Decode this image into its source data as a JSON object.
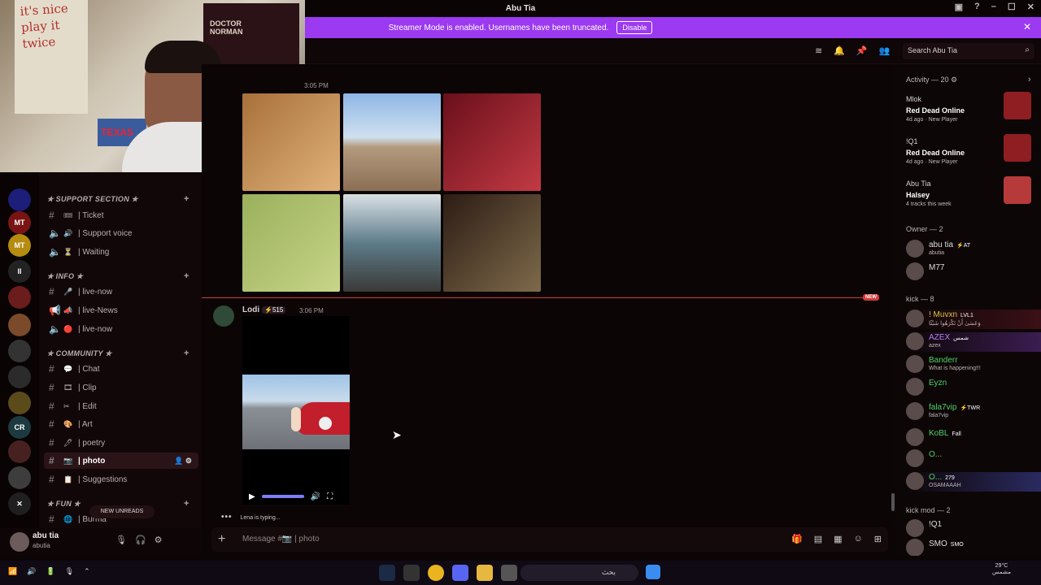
{
  "window": {
    "title": "Abu Tia"
  },
  "banner": {
    "text": "Streamer Mode is enabled. Usernames have been truncated.",
    "action": "Disable"
  },
  "header": {
    "search_placeholder": "Search Abu Tia"
  },
  "channels": {
    "categories": [
      {
        "name": "✯ SUPPORT SECTION ✯",
        "items": [
          {
            "icon": "🎟",
            "label": "| Ticket"
          },
          {
            "icon": "🔊",
            "label": "| Support voice"
          },
          {
            "icon": "⏳",
            "label": "| Waiting"
          }
        ]
      },
      {
        "name": "✯ INFO ✯",
        "items": [
          {
            "icon": "🎤",
            "label": "| live-now"
          },
          {
            "icon": "📣",
            "label": "| live-News"
          },
          {
            "icon": "🔴",
            "label": "| live-now"
          }
        ]
      },
      {
        "name": "✯ COMMUNITY ✯",
        "items": [
          {
            "icon": "💬",
            "label": "| Chat"
          },
          {
            "icon": "🎞",
            "label": "| Clip"
          },
          {
            "icon": "✂",
            "label": "| Edit"
          },
          {
            "icon": "🎨",
            "label": "| Art"
          },
          {
            "icon": "🖊",
            "label": "| poetry"
          },
          {
            "icon": "📷",
            "label": "| photo"
          },
          {
            "icon": "📋",
            "label": "| Suggestions"
          }
        ]
      },
      {
        "name": "✯ FUN ✯",
        "items": [
          {
            "icon": "🌐",
            "label": "| Burma"
          }
        ]
      }
    ],
    "new_unreads": "NEW UNREADS"
  },
  "user": {
    "name": "abu tia",
    "tag": "abutia"
  },
  "messages": {
    "first_time": "3:05 PM",
    "new_badge": "NEW",
    "second": {
      "author": "Lodi",
      "badge": "⚡515",
      "time": "3:06 PM"
    },
    "typing": "Lena is typing...",
    "composer_placeholder": "Message #📷 | photo"
  },
  "activity": {
    "title": "Activity — 20",
    "items": [
      {
        "user": "Mlok",
        "game": "Red Dead Online",
        "meta": "4d ago · New Player",
        "color": "#8f1e22"
      },
      {
        "user": "!Q1",
        "game": "Red Dead Online",
        "meta": "4d ago · New Player",
        "color": "#8f1e22"
      },
      {
        "user": "Abu Tia",
        "game": "Halsey",
        "meta": "4 tracks this week",
        "color": "#b63a3a"
      }
    ]
  },
  "member_groups": [
    {
      "title": "Owner — 2",
      "members": [
        {
          "name": "abu tia",
          "tag": "⚡AT",
          "sub": "abutia"
        },
        {
          "name": "M77",
          "tag": "",
          "sub": ""
        }
      ]
    },
    {
      "title": "kick — 8",
      "members": [
        {
          "name": "! Muvxn",
          "tag": "LVL1",
          "sub": "وَعَسَىٰ أَنْ تَكْرَهُوا شَيْئًا"
        },
        {
          "name": "AZEX",
          "tag": "شمس",
          "sub": "azex"
        },
        {
          "name": "Banderr",
          "tag": "",
          "sub": "What is happening!!!"
        },
        {
          "name": "Eyzn",
          "tag": "",
          "sub": ""
        },
        {
          "name": "fala7vip",
          "tag": "⚡TWR",
          "sub": "fala7vip"
        },
        {
          "name": "KoBL",
          "tag": "Fall",
          "sub": ""
        },
        {
          "name": "O...",
          "tag": "",
          "sub": ""
        },
        {
          "name": "O...",
          "tag": "279",
          "sub": "OSAMAAAH"
        }
      ]
    },
    {
      "title": "kick mod — 2",
      "members": [
        {
          "name": "!Q1",
          "tag": "",
          "sub": ""
        },
        {
          "name": "SMO",
          "tag": "SMO",
          "sub": ""
        }
      ]
    }
  ],
  "taskbar": {
    "search": "بحث",
    "weather": "29°C",
    "weather_label": "مشمس"
  }
}
